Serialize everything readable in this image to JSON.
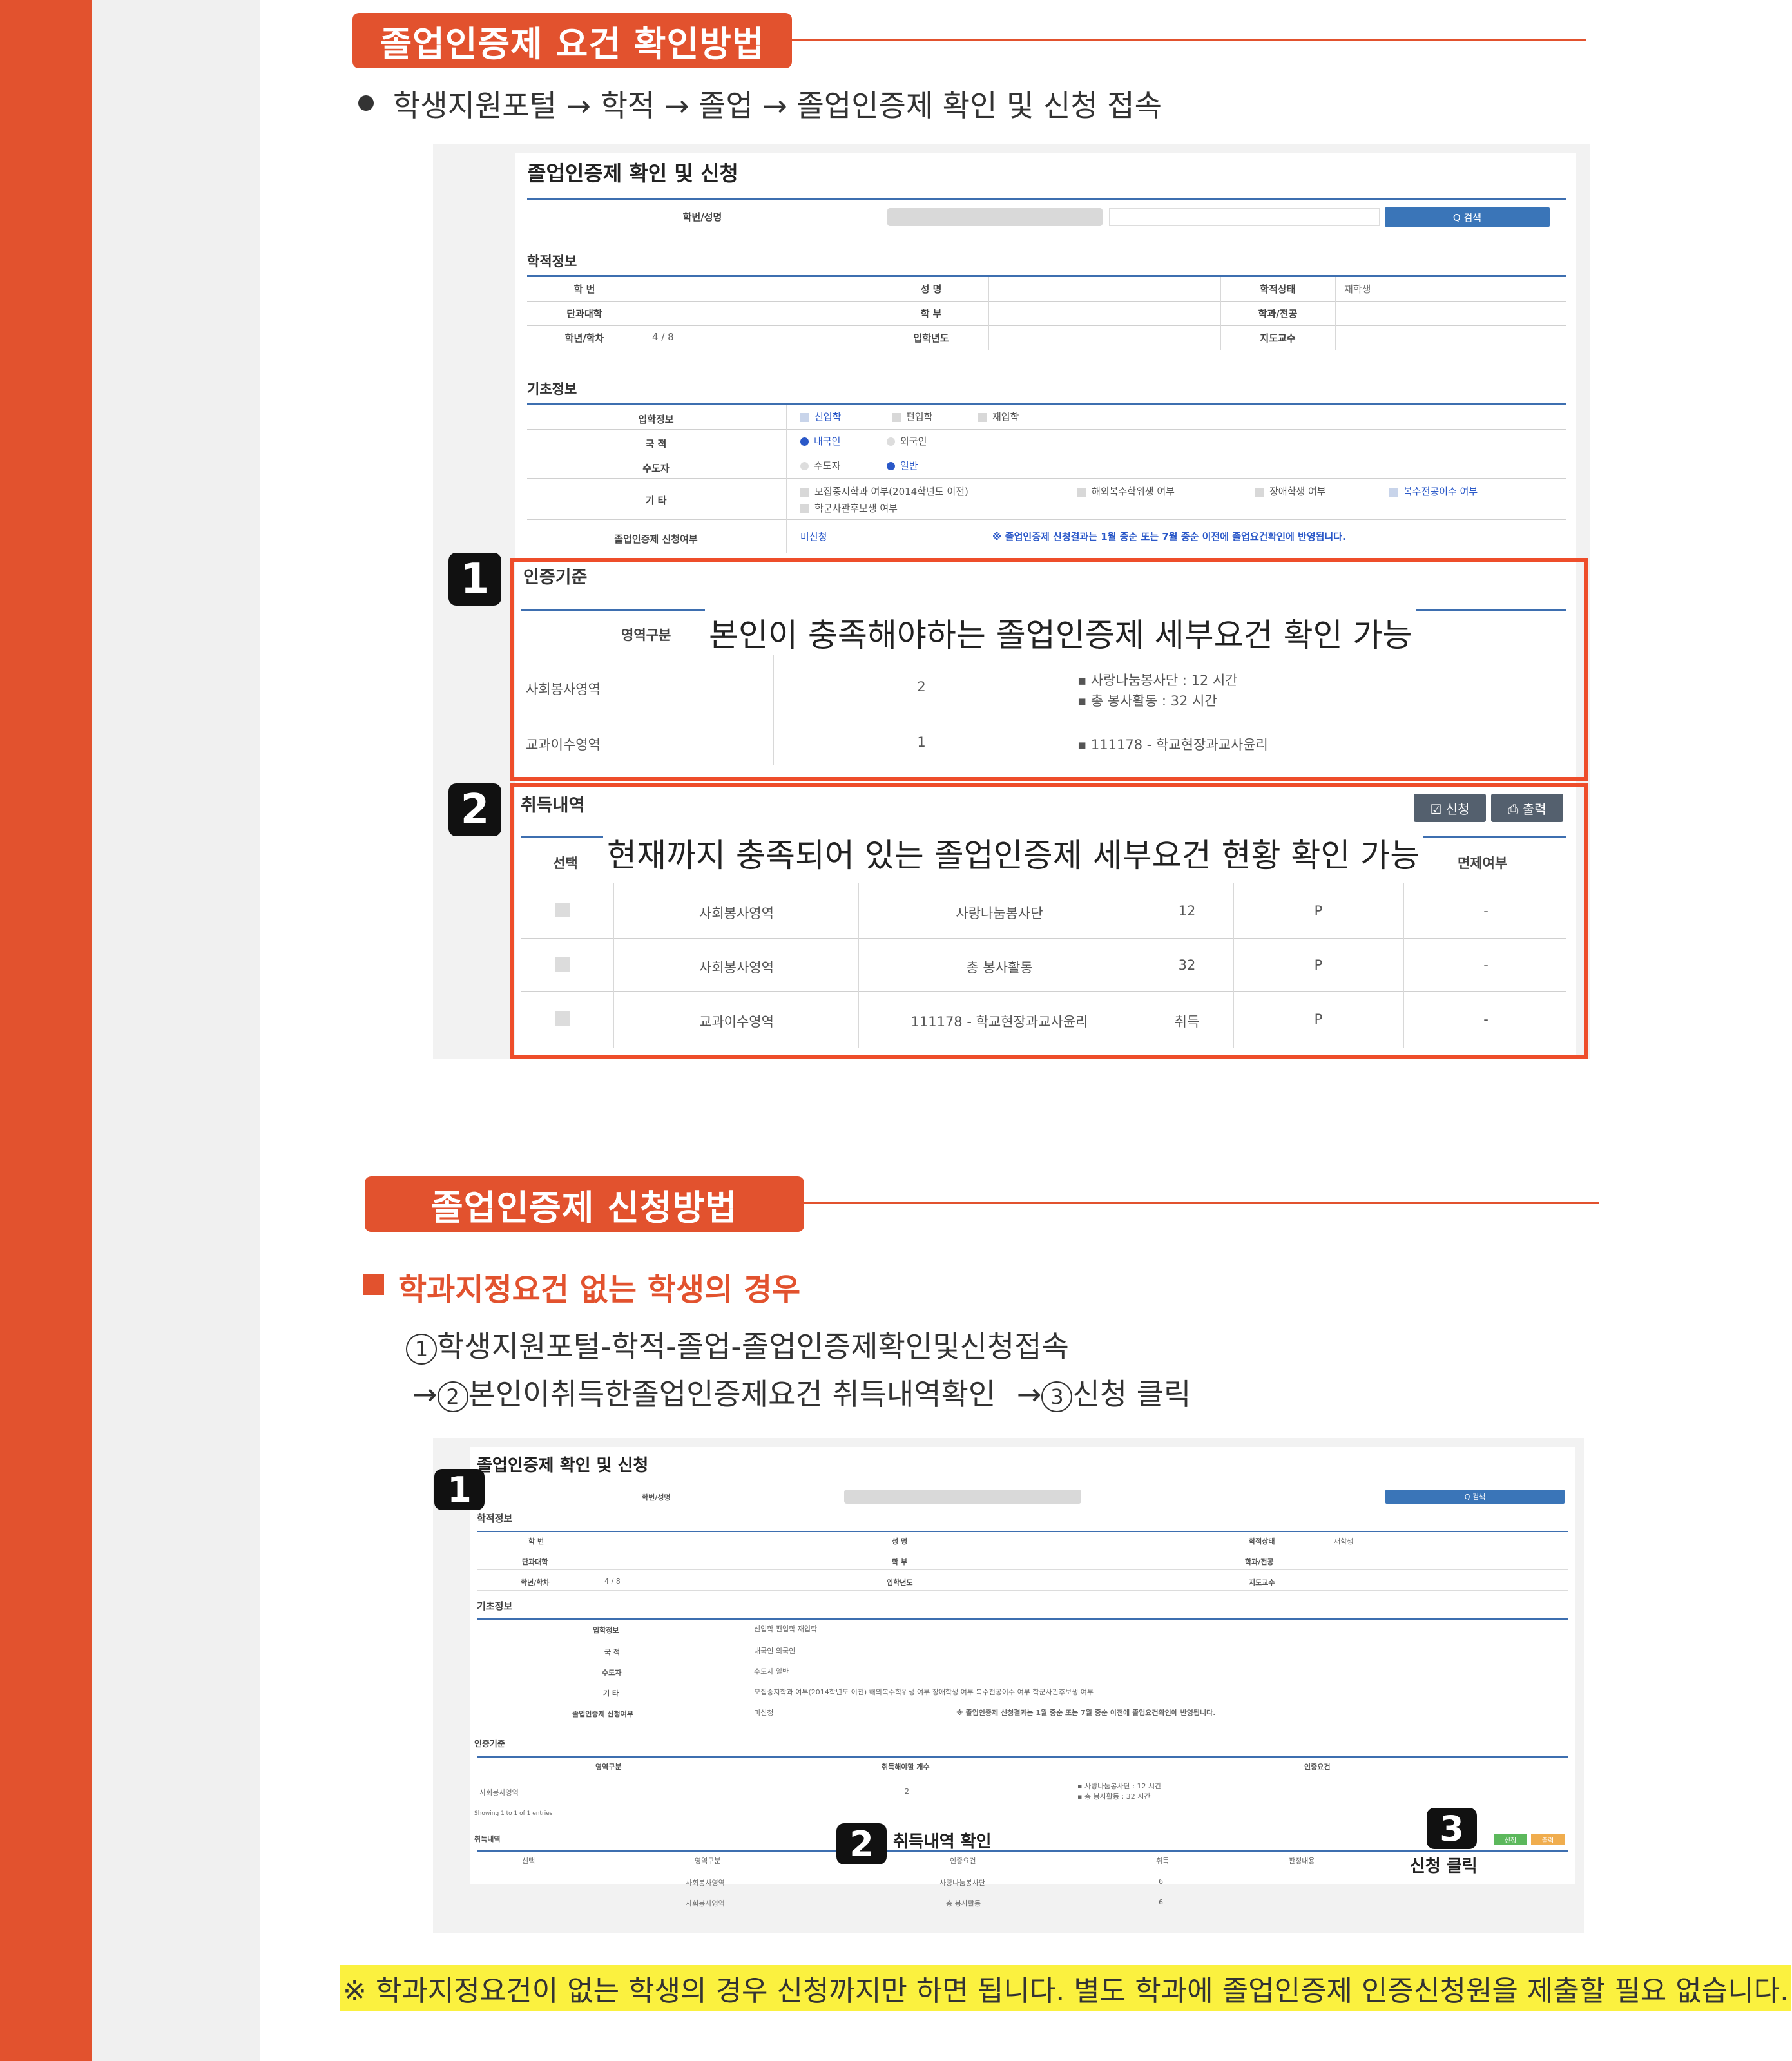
{
  "section1": {
    "title": "졸업인증제 요건 확인방법",
    "path": "학생지원포털 → 학적 → 졸업 → 졸업인증제 확인 및 신청 접속"
  },
  "screen1": {
    "title": "졸업인증제 확인 및 신청",
    "search_label": "학번/성명",
    "search_button": "Q 검색",
    "academic": {
      "title": "학적정보",
      "row1": [
        "학 번",
        "",
        "성 명",
        "",
        "학적상태",
        "재학생"
      ],
      "row2": [
        "단과대학",
        "",
        "학 부",
        "",
        "학과/전공",
        ""
      ],
      "row3": [
        "학년/학차",
        "4 / 8",
        "입학년도",
        "",
        "지도교수",
        ""
      ]
    },
    "basic": {
      "title": "기초정보",
      "admission_label": "입학정보",
      "admission_opts": [
        "신입학",
        "편입학",
        "재입학"
      ],
      "nationality_label": "국 적",
      "nationality_opts": [
        "내국인",
        "외국인"
      ],
      "capital_label": "수도자",
      "capital_opts": [
        "수도자",
        "일반"
      ],
      "etc_label": "기 타",
      "etc_opts": [
        "모집중지학과 여부(2014학년도 이전)",
        "해외복수학위생 여부",
        "장애학생 여부",
        "복수전공이수 여부"
      ],
      "etc_opt5": "학군사관후보생 여부",
      "apply_label": "졸업인증제 신청여부",
      "apply_value": "미신청",
      "apply_note": "※ 졸업인증제 신청결과는 1월 중순 또는 7월 중순 이전에 졸업요건확인에 반영됩니다."
    },
    "cert": {
      "marker": "1",
      "title": "인증기준",
      "col_area": "영역구분",
      "overlay": "본인이 충족해야하는  졸업인증제 세부요건 확인 가능",
      "rows": [
        {
          "area": "사회봉사영역",
          "count": "2",
          "detail1": "▪ 사랑나눔봉사단 : 12 시간",
          "detail2": "▪ 총 봉사활동 : 32 시간"
        },
        {
          "area": "교과이수영역",
          "count": "1",
          "detail1": "▪ 111178 - 학교현장과교사윤리",
          "detail2": ""
        }
      ]
    },
    "acq": {
      "marker": "2",
      "title": "취득내역",
      "btn_apply": "☑ 신청",
      "btn_print": "⎙ 출력",
      "col_select": "선택",
      "col_exempt": "면제여부",
      "overlay": "현재까지 충족되어 있는 졸업인증제 세부요건 현황 확인 가능",
      "rows": [
        {
          "area": "사회봉사영역",
          "item": "사랑나눔봉사단",
          "value": "12",
          "result": "P",
          "exempt": "-"
        },
        {
          "area": "사회봉사영역",
          "item": "총 봉사활동",
          "value": "32",
          "result": "P",
          "exempt": "-"
        },
        {
          "area": "교과이수영역",
          "item": "111178 - 학교현장과교사윤리",
          "value": "취득",
          "result": "P",
          "exempt": "-"
        }
      ]
    }
  },
  "section2": {
    "title": "졸업인증제 신청방법",
    "subhead": "학과지정요건 없는 학생의 경우",
    "step1_num": "1",
    "step1": "학생지원포털-학적-졸업-졸업인증제확인및신청접속",
    "arrow": "→",
    "step2_num": "2",
    "step2": "본인이취득한졸업인증제요건 취득내역확인",
    "step3_num": "3",
    "step3": "신청 클릭"
  },
  "screen2": {
    "title": "졸업인증제 확인 및 신청",
    "marker1": "1",
    "marker2": "2",
    "marker3": "3",
    "search_label": "학번/성명",
    "search_button": "Q 검색",
    "academic_title": "학적정보",
    "a_row1": [
      "학 번",
      "성 명",
      "학적상태",
      "재학생"
    ],
    "a_row2": [
      "단과대학",
      "학 부",
      "학과/전공"
    ],
    "a_row3": [
      "학년/학차",
      "4 / 8",
      "입학년도",
      "지도교수"
    ],
    "basic_title": "기초정보",
    "b_labels": [
      "입학정보",
      "국 적",
      "수도자",
      "기 타",
      "졸업인증제 신청여부"
    ],
    "b_admission": "신입학   편입학   재입학",
    "b_nation": "내국인   외국인",
    "b_capital": "수도자   일반",
    "b_etc": "모집중지학과 여부(2014학년도 이전)   해외복수학위생 여부   장애학생 여부   복수전공이수 여부   학군사관후보생 여부",
    "b_apply": "미신청",
    "b_note": "※ 졸업인증제 신청결과는 1월 중순 또는 7월 중순 이전에 졸업요건확인에 반영됩니다.",
    "cert_title": "인증기준",
    "cert_cols": [
      "영역구분",
      "취득해야할 개수",
      "인증요건"
    ],
    "cert_row": [
      "사회봉사영역",
      "2",
      "▪ 사랑나눔봉사단 : 12 시간",
      "▪ 총 봉사활동 : 32 시간"
    ],
    "showing": "Showing 1 to 1 of 1 entries",
    "acq_title": "취득내역",
    "acq_cols": [
      "선택",
      "영역구분",
      "인증요건",
      "취득",
      "판정내용"
    ],
    "acq_rows": [
      [
        "사회봉사영역",
        "사랑나눔봉사단",
        "6"
      ],
      [
        "사회봉사영역",
        "총 봉사활동",
        "6"
      ]
    ],
    "callout2": "취득내역 확인",
    "callout3": "신청 클릭",
    "btn_apply": "신청",
    "btn_print": "출력"
  },
  "note": "※ 학과지정요건이 없는 학생의 경우 신청까지만 하면 됩니다. 별도 학과에 졸업인증제 인증신청원을 제출할 필요 없습니다."
}
